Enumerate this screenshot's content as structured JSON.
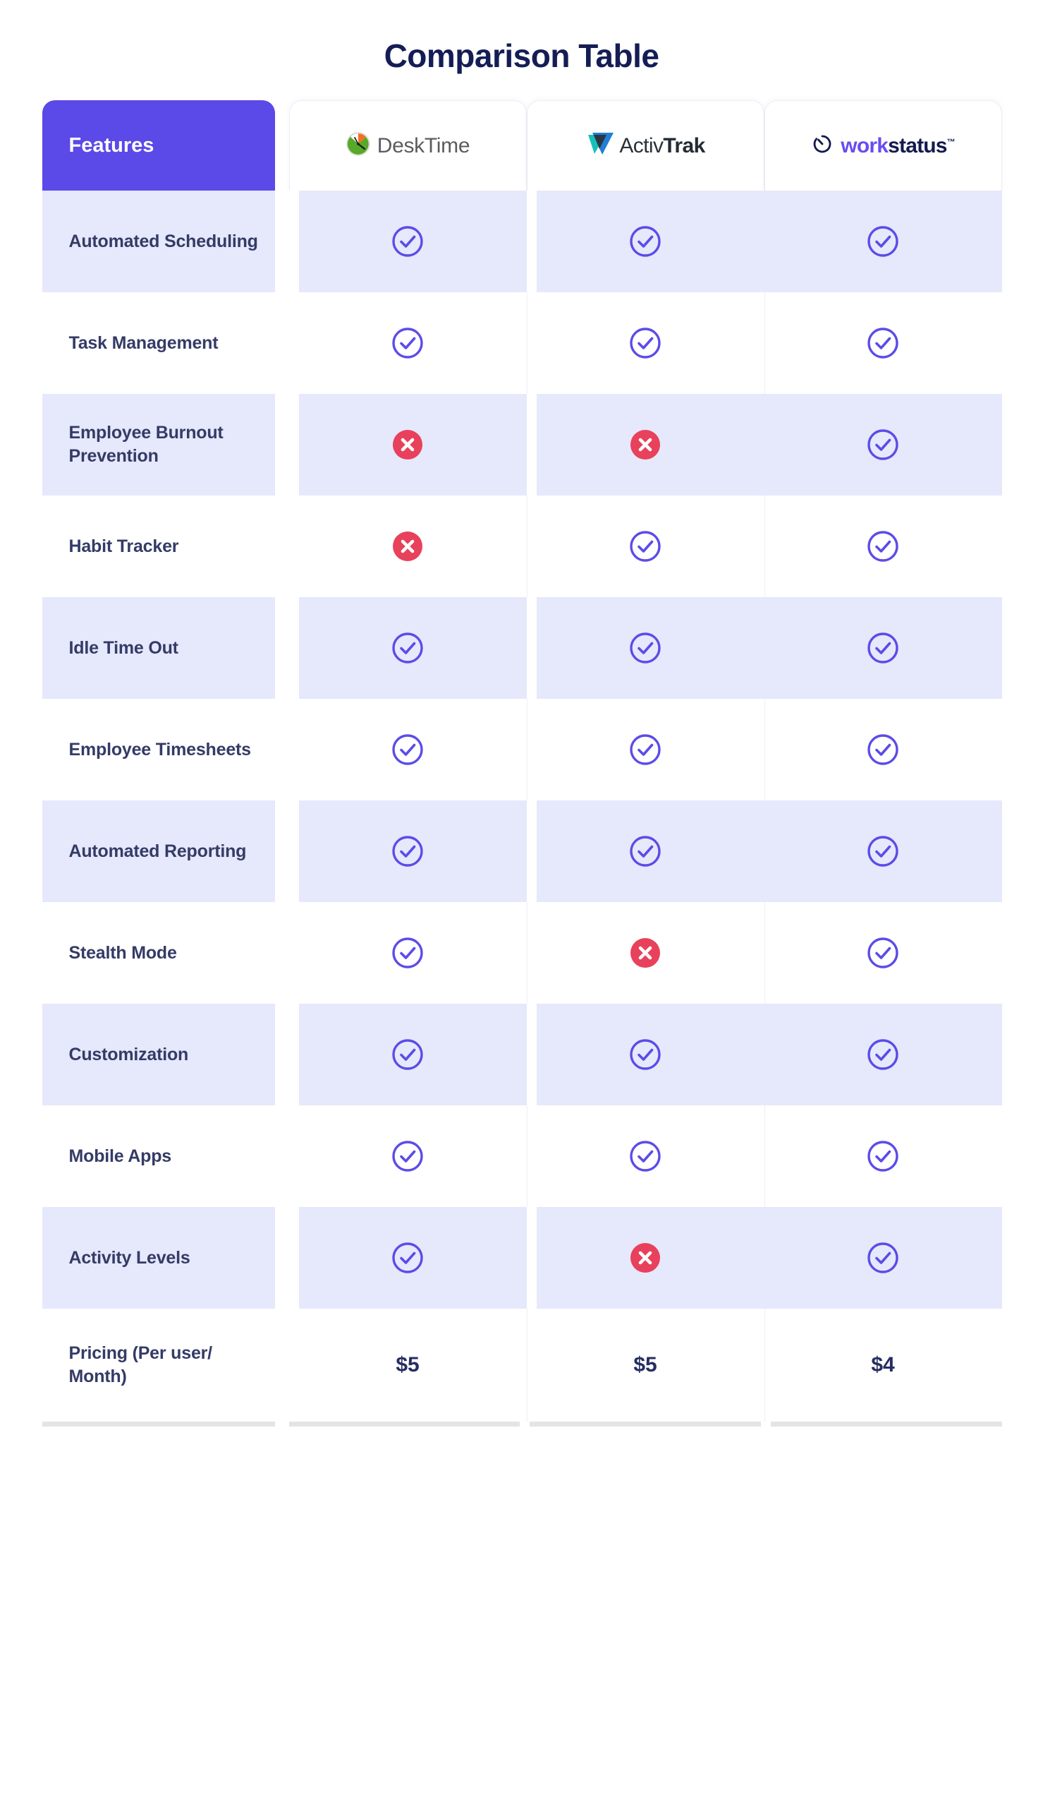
{
  "title": "Comparison Table",
  "colors": {
    "header_accent": "#5b49e8",
    "row_shade": "#e6e8fb",
    "check": "#5b4ce8",
    "cross": "#e8415b",
    "text_dark": "#343b66",
    "title": "#141d55"
  },
  "header": {
    "features_label": "Features",
    "columns": [
      {
        "id": "desktime",
        "name": "DeskTime",
        "icon": "clock-icon"
      },
      {
        "id": "activtrak",
        "name_light": "Activ",
        "name_bold": "Trak",
        "icon": "triangle-icon"
      },
      {
        "id": "workstatus",
        "name_purple": "work",
        "name_dark": "status",
        "tm": "™",
        "icon": "timer-icon"
      }
    ]
  },
  "rows": [
    {
      "feature": "Automated Scheduling",
      "values": [
        "check",
        "check",
        "check"
      ],
      "shaded": true
    },
    {
      "feature": "Task Management",
      "values": [
        "check",
        "check",
        "check"
      ],
      "shaded": false
    },
    {
      "feature": "Employee Burnout Prevention",
      "values": [
        "cross",
        "cross",
        "check"
      ],
      "shaded": true
    },
    {
      "feature": "Habit Tracker",
      "values": [
        "cross",
        "check",
        "check"
      ],
      "shaded": false
    },
    {
      "feature": "Idle Time Out",
      "values": [
        "check",
        "check",
        "check"
      ],
      "shaded": true
    },
    {
      "feature": "Employee Timesheets",
      "values": [
        "check",
        "check",
        "check"
      ],
      "shaded": false
    },
    {
      "feature": "Automated Reporting",
      "values": [
        "check",
        "check",
        "check"
      ],
      "shaded": true
    },
    {
      "feature": "Stealth Mode",
      "values": [
        "check",
        "cross",
        "check"
      ],
      "shaded": false
    },
    {
      "feature": "Customization",
      "values": [
        "check",
        "check",
        "check"
      ],
      "shaded": true
    },
    {
      "feature": "Mobile Apps",
      "values": [
        "check",
        "check",
        "check"
      ],
      "shaded": false
    },
    {
      "feature": "Activity Levels",
      "values": [
        "check",
        "cross",
        "check"
      ],
      "shaded": true
    },
    {
      "feature": "Pricing (Per user/ Month)",
      "values": [
        "$5",
        "$5",
        "$4"
      ],
      "shaded": false,
      "type": "price"
    }
  ]
}
